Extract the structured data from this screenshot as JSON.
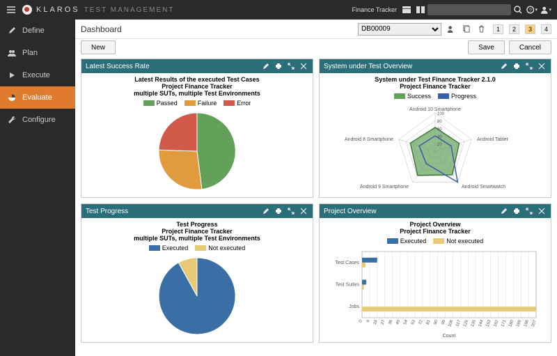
{
  "brand": {
    "name": "KLAROS",
    "suffix": "TEST MANAGEMENT"
  },
  "topbar": {
    "project_label": "Finance Tracker",
    "search_placeholder": ""
  },
  "sidebar": {
    "items": [
      {
        "label": "Define"
      },
      {
        "label": "Plan"
      },
      {
        "label": "Execute"
      },
      {
        "label": "Evaluate"
      },
      {
        "label": "Configure"
      }
    ]
  },
  "page": {
    "title": "Dashboard",
    "select_value": "DB00009",
    "crumbs": [
      "1",
      "2",
      "3",
      "4"
    ],
    "new_btn": "New",
    "save_btn": "Save",
    "cancel_btn": "Cancel"
  },
  "panels": {
    "success": {
      "title": "Latest Success Rate",
      "chart_title": "Latest Results of the executed Test Cases",
      "chart_sub1": "Project Finance Tracker",
      "chart_sub2": "multiple SUTs, multiple Test Environments",
      "legend": {
        "passed": "Passed",
        "failure": "Failure",
        "error": "Error"
      }
    },
    "sut": {
      "title": "System under Test Overview",
      "chart_title": "System under Test Finance Tracker 2.1.0",
      "chart_sub1": "Project Finance Tracker",
      "legend": {
        "success": "Success",
        "progress": "Progress"
      },
      "axes": [
        "Android 10 Smartphone",
        "Android Tablet",
        "Android Smartwatch",
        "Android 9 Smartphone",
        "Android 8 Smartphone"
      ],
      "ticks": [
        "100",
        "80",
        "60",
        "40",
        "20"
      ]
    },
    "progress": {
      "title": "Test Progress",
      "chart_title": "Test Progress",
      "chart_sub1": "Project Finance Tracker",
      "chart_sub2": "multiple SUTs, multiple Test Environments",
      "legend": {
        "exec": "Executed",
        "notexec": "Not executed"
      }
    },
    "overview": {
      "title": "Project Overview",
      "chart_title": "Project Overview",
      "chart_sub1": "Project Finance Tracker",
      "legend": {
        "exec": "Executed",
        "notexec": "Not executed"
      },
      "categories": [
        "Test Cases",
        "Test Suites",
        "Jobs"
      ],
      "xlabel": "Count",
      "ticks": [
        "0",
        "9",
        "18",
        "27",
        "36",
        "45",
        "54",
        "63",
        "72",
        "81",
        "90",
        "99",
        "108",
        "117",
        "126",
        "135",
        "144",
        "153",
        "162",
        "171",
        "180",
        "189",
        "198",
        "207"
      ]
    }
  },
  "chart_data": [
    {
      "type": "pie",
      "title": "Latest Success Rate",
      "series": [
        {
          "name": "Passed",
          "value": 52,
          "color": "#63a05a"
        },
        {
          "name": "Failure",
          "value": 25,
          "color": "#e19a3e"
        },
        {
          "name": "Error",
          "value": 23,
          "color": "#d15a4a"
        }
      ]
    },
    {
      "type": "radar",
      "title": "System under Test Overview",
      "axes": [
        "Android 10 Smartphone",
        "Android Tablet",
        "Android Smartwatch",
        "Android 9 Smartphone",
        "Android 8 Smartphone"
      ],
      "range": [
        0,
        100
      ],
      "series": [
        {
          "name": "Success",
          "color": "#63a05a",
          "values": [
            62,
            66,
            76,
            78,
            68
          ]
        },
        {
          "name": "Progress",
          "color": "#3a5fa6",
          "values": [
            40,
            44,
            100,
            40,
            44
          ]
        }
      ]
    },
    {
      "type": "pie",
      "title": "Test Progress",
      "series": [
        {
          "name": "Executed",
          "value": 92,
          "color": "#3a6fa6"
        },
        {
          "name": "Not executed",
          "value": 8,
          "color": "#e8c977"
        }
      ]
    },
    {
      "type": "bar",
      "orientation": "horizontal",
      "title": "Project Overview",
      "categories": [
        "Test Cases",
        "Test Suites",
        "Jobs"
      ],
      "xlabel": "Count",
      "xlim": [
        0,
        207
      ],
      "series": [
        {
          "name": "Executed",
          "color": "#3a6fa6",
          "values": [
            18,
            5,
            0
          ]
        },
        {
          "name": "Not executed",
          "color": "#e8c977",
          "values": [
            4,
            2,
            207
          ]
        }
      ]
    }
  ]
}
